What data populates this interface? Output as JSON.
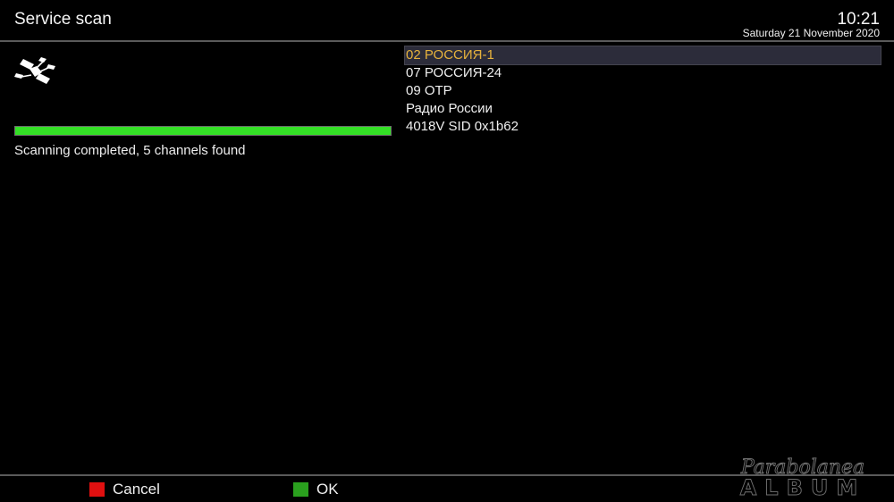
{
  "header": {
    "title": "Service scan",
    "time": "10:21",
    "date": "Saturday 21 November 2020"
  },
  "scan": {
    "progress_percent": 100,
    "status": "Scanning completed, 5 channels found"
  },
  "channels": [
    {
      "label": "02 РОССИЯ-1",
      "selected": true
    },
    {
      "label": "07 РОССИЯ-24",
      "selected": false
    },
    {
      "label": "09 ОТР",
      "selected": false
    },
    {
      "label": "Радио России",
      "selected": false
    },
    {
      "label": "4018V SID 0x1b62",
      "selected": false
    }
  ],
  "footer": {
    "cancel_label": "Cancel",
    "ok_label": "OK"
  },
  "colors": {
    "accent_selected": "#e6b23c",
    "progress": "#34e026",
    "key_red": "#e01010",
    "key_green": "#2aa01e"
  },
  "watermark": {
    "line1": "Parabolanea",
    "line2": "ALBUM"
  }
}
